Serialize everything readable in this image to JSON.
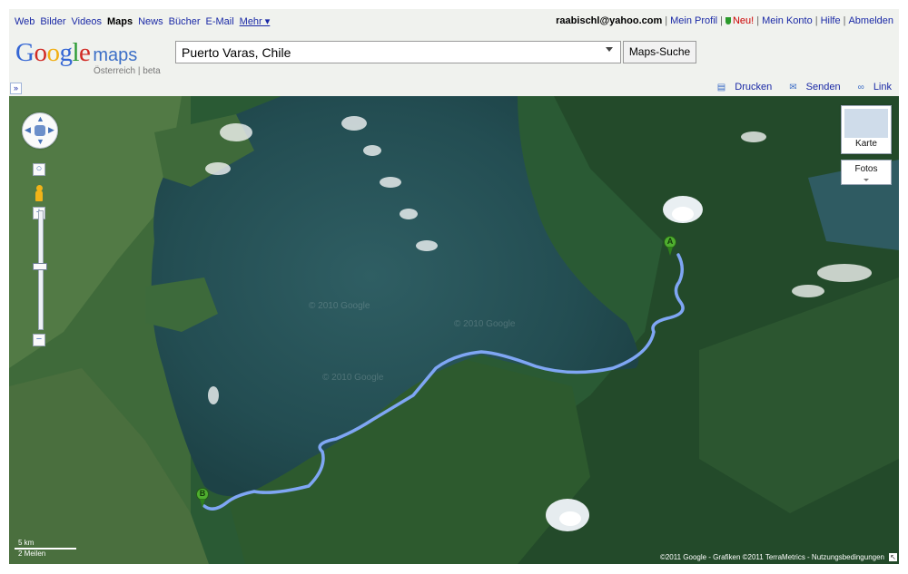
{
  "nav": {
    "links": [
      "Web",
      "Bilder",
      "Videos",
      "Maps",
      "News",
      "Bücher",
      "E-Mail"
    ],
    "active": "Maps",
    "more": "Mehr ▾"
  },
  "user": {
    "email": "raabischl@yahoo.com",
    "profile": "Mein Profil",
    "new": "Neu!",
    "account": "Mein Konto",
    "help": "Hilfe",
    "logout": "Abmelden"
  },
  "logo": {
    "google": "Google",
    "maps": "maps",
    "sub": "Österreich | beta",
    "colors": [
      "#3466d4",
      "#d12a23",
      "#f1ae12",
      "#3466d4",
      "#2b9b33",
      "#d12a23"
    ]
  },
  "search": {
    "value": "Puerto Varas, Chile",
    "button": "Maps-Suche"
  },
  "toolbar": {
    "collapse": "»",
    "print": "Drucken",
    "send": "Senden",
    "link": "Link"
  },
  "map": {
    "type_button": "Karte",
    "photos_button": "Fotos",
    "marker_a": "A",
    "marker_b": "B",
    "scale_km": "5 km",
    "scale_mi": "2 Meilen",
    "copyright": "©2011 Google - Grafiken ©2011 TerraMetrics - Nutzungsbedingungen",
    "watermarks": [
      "© 2010 Google",
      "© 2010 Google",
      "© 2010 Google"
    ],
    "route_color": "#7fa6f4"
  }
}
